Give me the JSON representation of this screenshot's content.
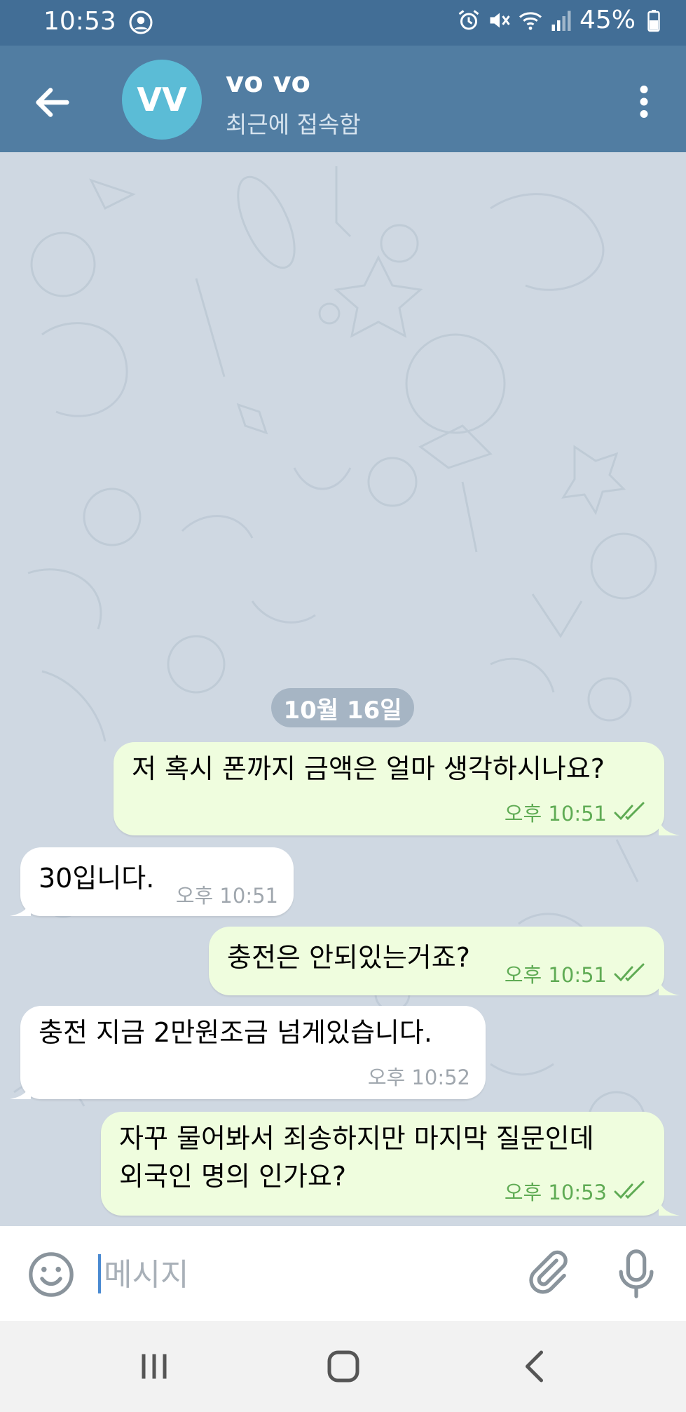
{
  "status_bar": {
    "time": "10:53",
    "battery": "45%"
  },
  "header": {
    "avatar_initials": "VV",
    "title": "vo vo",
    "subtitle": "최근에 접속함"
  },
  "date_separator": "10월 16일",
  "messages": [
    {
      "direction": "outgoing",
      "text": "저 혹시 폰까지 금액은 얼마 생각하시나요?",
      "time": "오후 10:51",
      "read": true
    },
    {
      "direction": "incoming",
      "text": "30입니다.",
      "time": "오후 10:51"
    },
    {
      "direction": "outgoing",
      "text": "충전은 안되있는거죠?",
      "time": "오후 10:51",
      "read": true
    },
    {
      "direction": "incoming",
      "text": "충전 지금 2만원조금 넘게있습니다.",
      "time": "오후 10:52"
    },
    {
      "direction": "outgoing",
      "lines": [
        "자꾸 물어봐서 죄송하지만 마지막 질문인데",
        "외국인 명의 인가요?"
      ],
      "time": "오후 10:53",
      "read": true
    }
  ],
  "composer": {
    "placeholder": "메시지"
  },
  "colors": {
    "status_bar": "#426e96",
    "header": "#517da2",
    "chat_background": "#cfd8e2",
    "outgoing_bubble": "#effdde",
    "incoming_bubble": "#ffffff",
    "read_check": "#5fab54",
    "avatar": "#5bbcd6"
  },
  "icons": [
    "account-icon",
    "alarm-icon",
    "mute-icon",
    "wifi-icon",
    "signal-icon",
    "battery-icon",
    "back-arrow-icon",
    "more-vert-icon",
    "double-check-icon",
    "emoji-icon",
    "attach-icon",
    "mic-icon",
    "nav-recents-icon",
    "nav-home-icon",
    "nav-back-icon"
  ]
}
